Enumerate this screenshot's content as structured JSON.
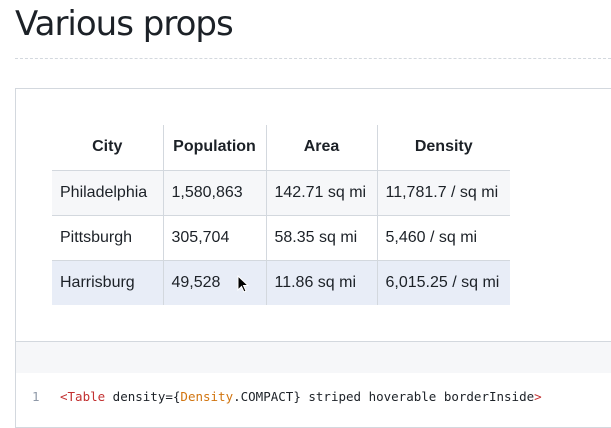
{
  "page": {
    "title": "Various props"
  },
  "table": {
    "headers": [
      "City",
      "Population",
      "Area",
      "Density"
    ],
    "rows": [
      [
        "Philadelphia",
        "1,580,863",
        "142.71 sq mi",
        "11,781.7 / sq mi"
      ],
      [
        "Pittsburgh",
        "305,704",
        "58.35 sq mi",
        "5,460 / sq mi"
      ],
      [
        "Harrisburg",
        "49,528",
        "11.86 sq mi",
        "6,015.25 / sq mi"
      ]
    ]
  },
  "code": {
    "line_number": "1",
    "open_tag": "<Table",
    "attr_density": " density={",
    "density_enum": "Density",
    "density_value": ".COMPACT}",
    "flags": " striped hoverable borderInside",
    "close_tag": ">"
  },
  "colors": {
    "stripe": "#f6f7f9",
    "hover": "#e8edf7",
    "border": "#d3d8de",
    "code_tag": "#c23030",
    "code_constant": "#d1740f"
  },
  "icons": {
    "cursor": "mouse-pointer-icon"
  }
}
